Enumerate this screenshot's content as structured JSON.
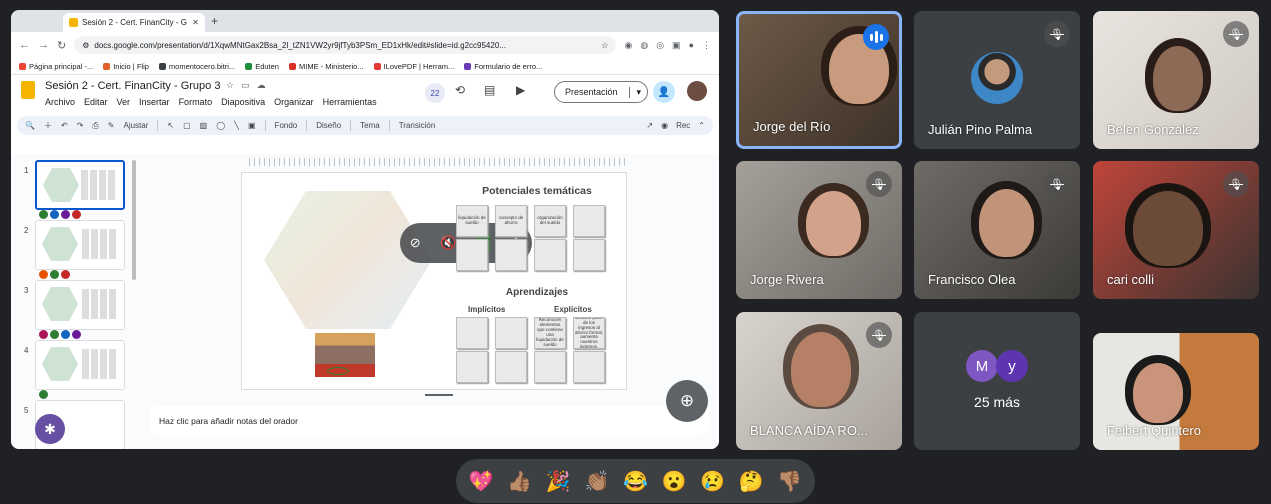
{
  "browser": {
    "tab_title": "Sesión 2 - Cert. FinanCity - G",
    "tab_close": "✕",
    "new_tab": "+",
    "url": "docs.google.com/presentation/d/1XqwMNtGax2Bsa_2l_tZN1VW2yr9jfTyb3PSm_ED1xHk/edit#slide=id.g2cc95420...",
    "bookmarks": [
      {
        "label": "Página principal -...",
        "color": "#ea4335"
      },
      {
        "label": "Inicio | Flip",
        "color": "#e0622a"
      },
      {
        "label": "momentocero.bitri...",
        "color": "#3c4043"
      },
      {
        "label": "Eduten",
        "color": "#1e8e3e"
      },
      {
        "label": "MIME - Ministerio...",
        "color": "#d93025"
      },
      {
        "label": "ILovePDF | Herram...",
        "color": "#e53935"
      },
      {
        "label": "Formulario de erro...",
        "color": "#673ab7"
      }
    ]
  },
  "slides": {
    "doc_title": "Sesión 2 - Cert. FinanCity - Grupo 3",
    "menu": [
      "Archivo",
      "Editar",
      "Ver",
      "Insertar",
      "Formato",
      "Diapositiva",
      "Organizar",
      "Herramientas"
    ],
    "collaborators": "22",
    "present_label": "Presentación",
    "toolbar": {
      "zoom_label": "Ajustar",
      "fondo": "Fondo",
      "diseno": "Diseño",
      "tema": "Tema",
      "transicion": "Transición",
      "rec": "Rec"
    },
    "thumbnails": [
      "1",
      "2",
      "3",
      "4",
      "5"
    ],
    "notes_placeholder": "Haz clic para añadir notas del orador"
  },
  "slide": {
    "potenciales_title": "Potenciales temáticas",
    "cards_top": [
      "liquidación de sueldo",
      "concepto de ahorro",
      "organización del sueldo",
      ""
    ],
    "aprendizajes_title": "Aprendizajes",
    "implicitos": "Implícitos",
    "explicitos": "Explícitos",
    "cards_bottom": [
      "",
      "",
      "Reconocen elementos que contiene una liquidación de sueldo",
      "Comprenden que el destinar parte de los ingresos al ahorro formal, aumenta nuestros ingresos, gracias al interés"
    ]
  },
  "participants": [
    {
      "name": "Jorge del Río",
      "state": "speaking"
    },
    {
      "name": "Julián Pino Palma",
      "state": "muted"
    },
    {
      "name": "Belen Gonzalez",
      "state": "muted"
    },
    {
      "name": "Jorge Rivera",
      "state": "muted"
    },
    {
      "name": "Francisco Olea",
      "state": "muted"
    },
    {
      "name": "cari colli",
      "state": "muted"
    },
    {
      "name": "BLANCA AÍDA RO...",
      "state": "muted"
    },
    {
      "name": "Feibert Quintero",
      "state": "unmuted"
    }
  ],
  "others": {
    "initials": [
      "M",
      "y"
    ],
    "colors": [
      "#7e57c2",
      "#5e35b1"
    ],
    "more_label": "25 más"
  },
  "reactions": [
    "💖",
    "👍🏽",
    "🎉",
    "👏🏽",
    "😂",
    "😮",
    "😢",
    "🤔",
    "👎🏽"
  ]
}
